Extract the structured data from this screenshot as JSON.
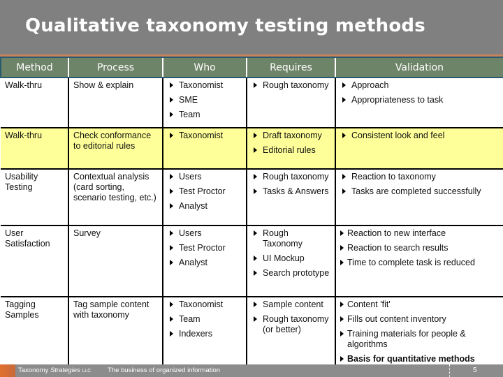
{
  "title": "Qualitative taxonomy testing methods",
  "columns": [
    "Method",
    "Process",
    "Who",
    "Requires",
    "Validation"
  ],
  "rows": [
    {
      "method": "Walk-thru",
      "process": "Show & explain",
      "who": [
        "Taxonomist",
        "SME",
        "Team"
      ],
      "requires": [
        "Rough taxonomy"
      ],
      "validation": [
        "Approach",
        "Appropriateness to task"
      ],
      "highlight": false
    },
    {
      "method": "Walk-thru",
      "process": "Check conformance to editorial rules",
      "who": [
        "Taxonomist"
      ],
      "requires": [
        "Draft taxonomy",
        "Editorial rules"
      ],
      "validation": [
        "Consistent look and feel"
      ],
      "highlight": true
    },
    {
      "method": "Usability Testing",
      "process": "Contextual analysis (card sorting, scenario testing, etc.)",
      "who": [
        "Users",
        "Test Proctor",
        "Analyst"
      ],
      "requires": [
        "Rough taxonomy",
        "Tasks & Answers"
      ],
      "validation": [
        "Reaction to taxonomy",
        "Tasks are completed successfully"
      ],
      "highlight": false
    },
    {
      "method": "User Satisfaction",
      "process": "Survey",
      "who": [
        "Users",
        "Test Proctor",
        "Analyst"
      ],
      "requires": [
        "Rough Taxonomy",
        "UI Mockup",
        "Search prototype"
      ],
      "validation": [
        "Reaction to new interface",
        "Reaction to search results",
        "Time to complete task is reduced"
      ],
      "highlight": false
    },
    {
      "method": "Tagging Samples",
      "process": "Tag sample content with taxonomy",
      "who": [
        "Taxonomist",
        "Team",
        "Indexers"
      ],
      "requires": [
        "Sample content",
        "Rough taxonomy (or better)"
      ],
      "validation": [
        "Content 'fit'",
        "Fills out content inventory",
        "Training materials for people & algorithms",
        "Basis for quantitative methods"
      ],
      "highlight": false
    }
  ],
  "footer": {
    "brand_prefix": "Taxonomy",
    "brand_italic": "Strategies",
    "brand_suffix": "LLC",
    "tagline": "The business of organized information",
    "page_number": "5"
  },
  "colors": {
    "title_bar": "#808080",
    "accent_line": "#c8835a",
    "header_bg": "#6e8468",
    "highlight_row": "#ffff99",
    "footer_bg": "#8c8c8c"
  },
  "icons": {
    "bullet": "triangle-right-icon"
  }
}
